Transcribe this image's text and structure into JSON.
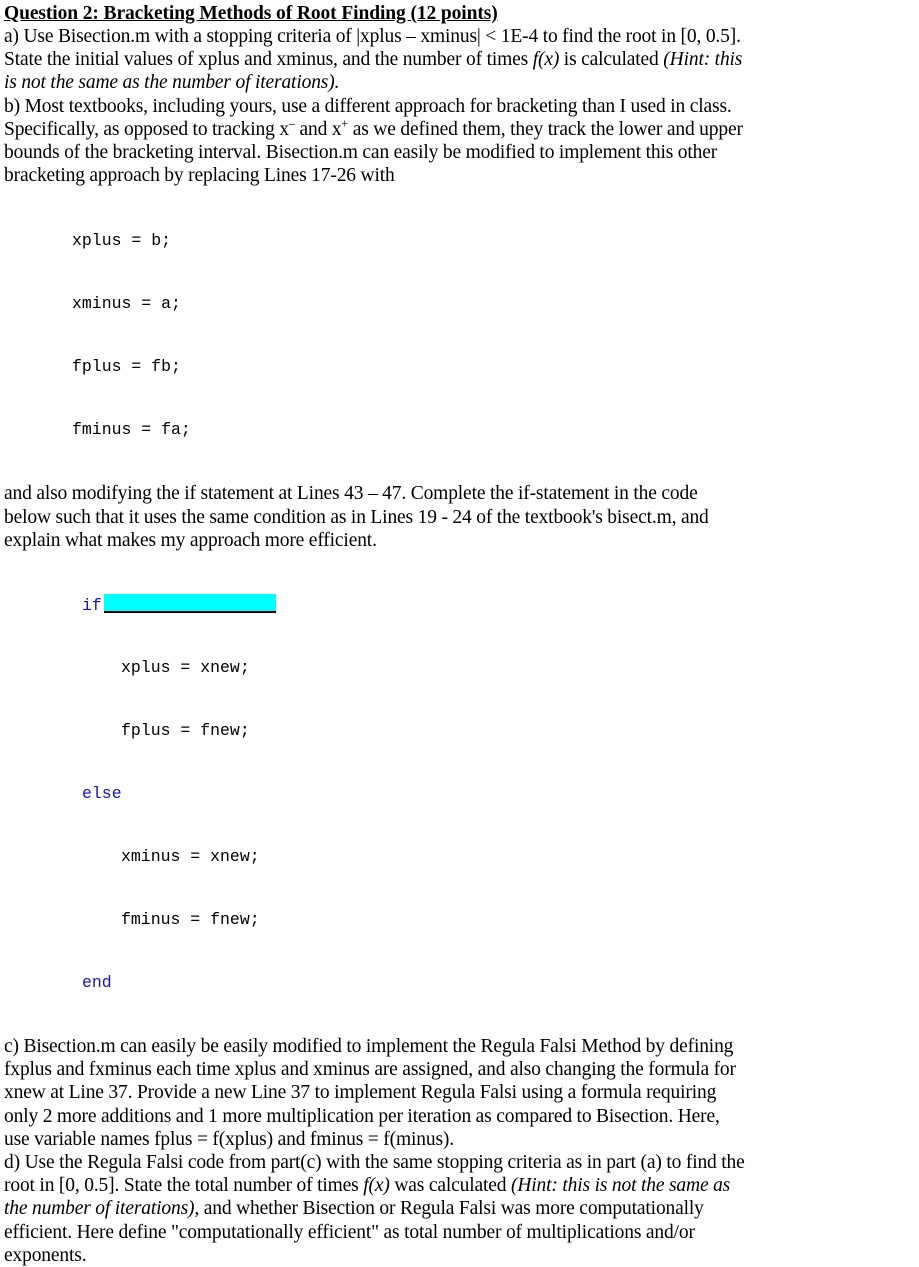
{
  "document": {
    "title": "Question 2: Bracketing Methods of Root Finding (12 points)",
    "parts": {
      "a": {
        "line1": "a) Use Bisection.m with a stopping criteria of |xplus – xminus| < 1E-4 to find the root in [0, 0.5].",
        "line2_pre": "State the initial values of xplus and xminus, and the number of times ",
        "line2_math": "f(x)",
        "line2_post": " is calculated ",
        "line2_hint": "(Hint: this",
        "line3_hint": "is not the same as the number of iterations)."
      },
      "b": {
        "line1": "b) Most textbooks, including yours, use a different approach for bracketing than I used in class.",
        "line2_pre": "Specifically, as opposed to tracking x",
        "line2_sup1": "–",
        "line2_mid": " and x",
        "line2_sup2": "+",
        "line2_post": " as we defined them, they track the lower and upper",
        "line3": "bounds of the bracketing interval. Bisection.m can easily be modified to implement this other",
        "line4": "bracketing approach by replacing Lines 17-26 with",
        "code": [
          "xplus = b;",
          "xminus = a;",
          "fplus = fb;",
          "fminus = fa;"
        ],
        "line5": "and also modifying the if statement at Lines 43 – 47. Complete the if-statement in the code",
        "line6": "below such that it uses the same condition as in Lines 19 - 24 of the textbook's bisect.m, and",
        "line7": "explain what makes my approach more efficient.",
        "code2": {
          "if_keyword": "if",
          "blank_value": "",
          "line_xplus": "xplus = xnew;",
          "line_fplus": "fplus = fnew;",
          "else_keyword": "else",
          "line_xminus": "xminus = xnew;",
          "line_fminus": "fminus = fnew;",
          "end_keyword": "end"
        }
      },
      "c": {
        "line1": "c) Bisection.m can easily be easily modified to implement the Regula Falsi Method by defining",
        "line2": "fxplus and fxminus each time xplus and xminus are assigned, and also changing the formula for",
        "line3": "xnew at Line 37. Provide a new Line 37 to implement Regula Falsi using a formula requiring",
        "line4": "only 2 more additions and 1 more multiplication per iteration as compared to Bisection. Here,",
        "line5": "use variable names fplus = f(xplus) and fminus = f(minus)."
      },
      "d": {
        "line1": "d) Use the Regula Falsi code from part(c) with the same stopping criteria as in part (a) to find the",
        "line2_pre": "root in [0, 0.5]. State the total number of times ",
        "line2_math": "f(x)",
        "line2_mid": " was calculated ",
        "line2_hint": "(Hint: this is not the same as",
        "line3_hint": "the number of iterations),",
        "line3_post": " and whether Bisection or Regula Falsi was more computationally",
        "line4": "efficient. Here define \"computationally efficient\" as total number of multiplications and/or",
        "line5": "exponents."
      }
    },
    "colors": {
      "highlight": "#00ffff",
      "keyword": "#1313c4",
      "text": "#000000",
      "background": "#ffffff"
    }
  }
}
